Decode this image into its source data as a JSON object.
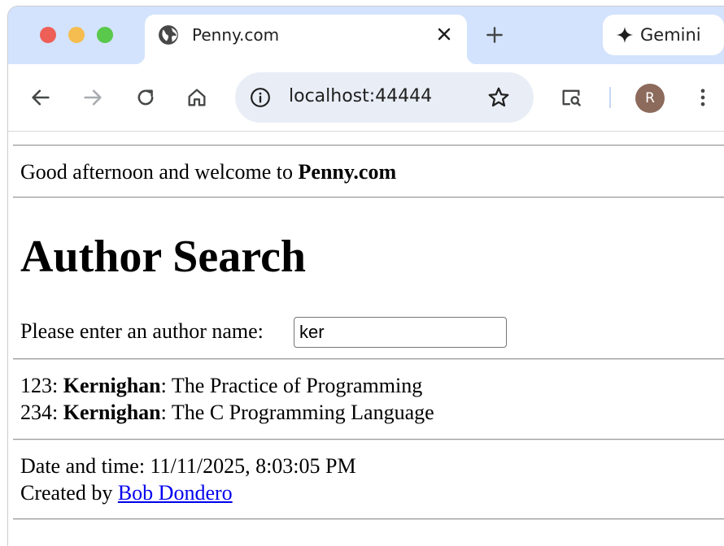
{
  "browser": {
    "tab_title": "Penny.com",
    "gemini_label": "Gemini",
    "url": "localhost:44444",
    "avatar_initial": "R"
  },
  "page": {
    "greeting_prefix": "Good afternoon and welcome to ",
    "greeting_site": "Penny.com",
    "heading": "Author Search",
    "search_label": "Please enter an author name: ",
    "search_value": "ker",
    "results": [
      {
        "id": "123:",
        "author": "Kernighan",
        "title": ": The Practice of Programming"
      },
      {
        "id": "234:",
        "author": "Kernighan",
        "title": ": The C Programming Language"
      }
    ],
    "datetime_text": "Date and time: 11/11/2025, 8:03:05 PM",
    "created_by_prefix": "Created by ",
    "created_by_link": "Bob Dondero"
  },
  "colors": {
    "tabstrip_bg": "#d3e3fd",
    "omnibox_bg": "#e9eef6",
    "link": "#0000ee",
    "avatar_bg": "#8c6a5c"
  },
  "icons": [
    "globe-icon",
    "close-icon",
    "plus-icon",
    "sparkle-icon",
    "back-arrow-icon",
    "forward-arrow-icon",
    "reload-icon",
    "home-icon",
    "info-icon",
    "star-icon",
    "lens-search-icon",
    "kebab-menu-icon"
  ]
}
